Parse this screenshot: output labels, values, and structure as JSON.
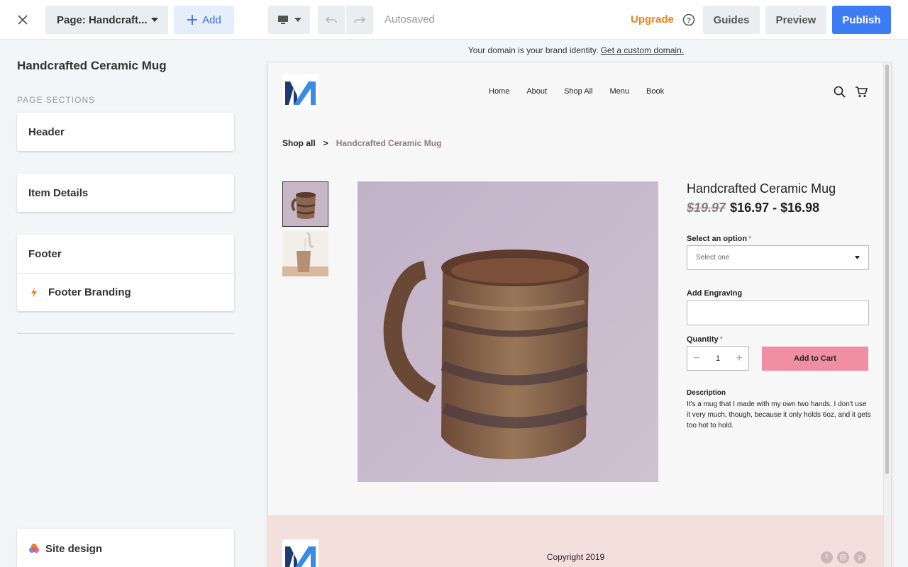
{
  "topbar": {
    "page_selector": "Page: Handcraft...",
    "add_label": "Add",
    "autosave_status": "Autosaved",
    "upgrade_label": "Upgrade",
    "guides_label": "Guides",
    "preview_label": "Preview",
    "publish_label": "Publish"
  },
  "sidebar": {
    "title": "Handcrafted Ceramic Mug",
    "sections_label": "PAGE SECTIONS",
    "sections": [
      {
        "label": "Header"
      },
      {
        "label": "Item Details"
      },
      {
        "label": "Footer"
      },
      {
        "label": "Footer Branding"
      }
    ],
    "site_design_label": "Site design"
  },
  "domain_banner": {
    "text": "Your domain is your brand identity.",
    "link": "Get a custom domain."
  },
  "site": {
    "nav": [
      "Home",
      "About",
      "Shop All",
      "Menu",
      "Book"
    ],
    "breadcrumb": {
      "link": "Shop all",
      "separator": ">",
      "current": "Handcrafted Ceramic Mug"
    },
    "product": {
      "title": "Handcrafted Ceramic Mug",
      "old_price": "$19.97",
      "price": "$16.97 - $16.98",
      "option_label": "Select an option",
      "option_placeholder": "Select one",
      "engraving_label": "Add Engraving",
      "quantity_label": "Quantity",
      "quantity": "1",
      "add_to_cart": "Add to Cart",
      "description_label": "Description",
      "description": "It's a mug that I made with my own two hands. I don't use it very much, though, because it only holds 6oz, and it gets too hot to hold."
    },
    "footer": {
      "copyright": "Copyright 2019"
    }
  },
  "colors": {
    "publish": "#3e7cf5",
    "upgrade": "#f0801e",
    "add_to_cart": "#f28ea2",
    "footer_bg": "#f3dfdb"
  }
}
